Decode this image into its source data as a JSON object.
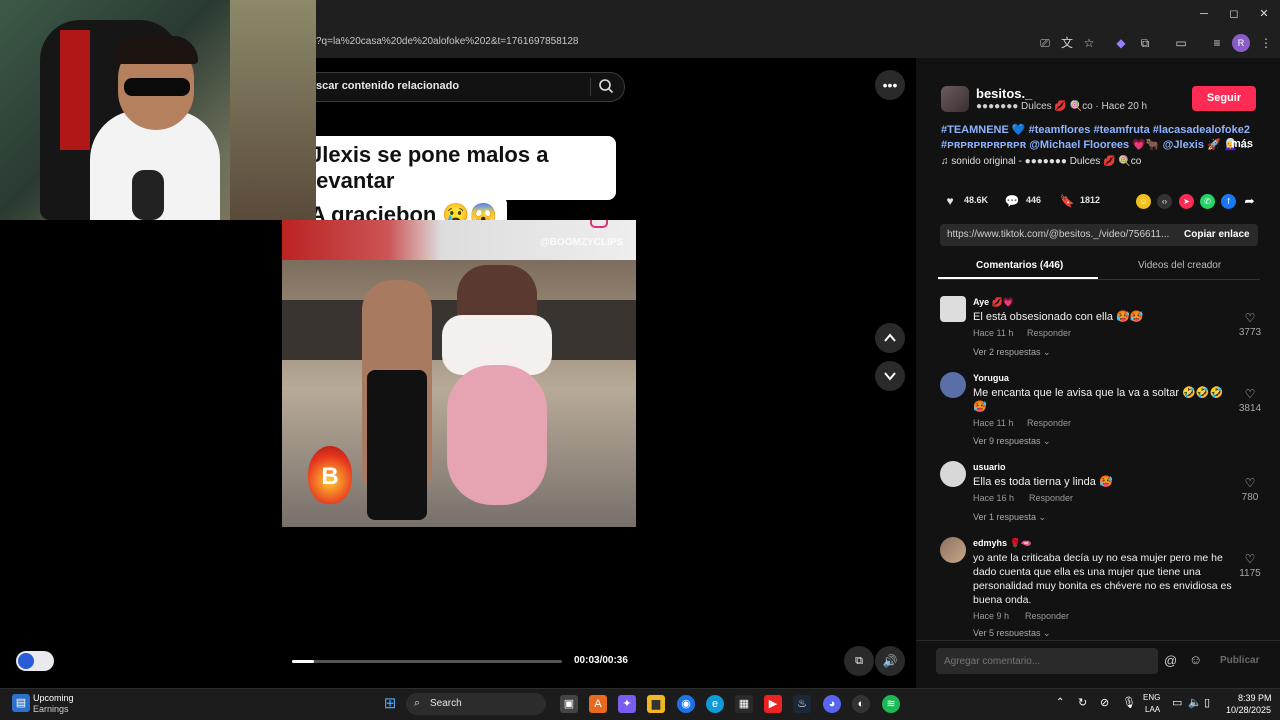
{
  "browser": {
    "url": "?q=la%20casa%20de%20alofoke%202&t=1761697858128",
    "window_controls": {
      "minimize": "─",
      "maximize": "◻",
      "close": "✕"
    },
    "profile_initial": "R"
  },
  "search": {
    "placeholder_text": "scar contenido relacionado"
  },
  "video": {
    "caption_line1": "Jlexis se pone malos a levantar",
    "caption_line2": "A graciebon 😢😱",
    "watermark": "@BOOMZYCLIPS",
    "badge_letter": "B",
    "time": "00:03/00:36",
    "progress": 0.083
  },
  "post": {
    "username": "besitos._",
    "subline": "●●●●●●● Dulces 💋 🍭co · Hace 20 h",
    "follow_label": "Seguir",
    "hashtags": "#TEAMNENE 💙 #teamflores #teamfruta #lacasadealofoke2 #ᴘʀᴘʀᴘʀᴘʀᴘʀᴘʀ @Michael Floorees 💗🐂 @Jlexis 🚀 👩‍🦳 ...",
    "more_label": "más",
    "sound": "♫  sonido original - ●●●●●●● Dulces 💋 🍭co",
    "likes": "48.6K",
    "comments": "446",
    "saves": "1812",
    "link": "https://www.tiktok.com/@besitos._/video/756611...",
    "copy_label": "Copiar enlace"
  },
  "tabs": {
    "comments": "Comentarios (446)",
    "videos": "Videos del creador"
  },
  "comments": [
    {
      "user": "Aye 💋💗",
      "text": "El está obsesionado con ella 🥵🥵",
      "time": "Hace 11 h",
      "reply": "Responder",
      "more": "Ver 2 respuestas ⌄",
      "likes": "3773"
    },
    {
      "user": "Yorugua",
      "text": "Me encanta que le avisa que la va a soltar 🤣🤣🤣",
      "text2": "🥵",
      "time": "Hace 11 h",
      "reply": "Responder",
      "more": "Ver 9 respuestas ⌄",
      "likes": "3814"
    },
    {
      "user": "usuario",
      "text": "Ella es toda tierna y linda 🥵",
      "time": "Hace 16 h",
      "reply": "Responder",
      "more": "Ver 1 respuesta ⌄",
      "likes": "780"
    },
    {
      "user": "edmyhs 🌹🫦",
      "text": "yo ante la criticaba decía uy no esa mujer pero me he dado cuenta que ella es una mujer que tiene una personalidad muy bonita es chévere no es envidiosa es buena onda.",
      "time": "Hace 9 h",
      "reply": "Responder",
      "more": "Ver 5 respuestas ⌄",
      "likes": "1175"
    }
  ],
  "comment_input": {
    "placeholder": "Agregar comentario..."
  },
  "publish_label": "Publicar",
  "taskbar": {
    "widget_title": "Upcoming",
    "widget_sub": "Earnings",
    "search_label": "Search",
    "lang1": "ENG",
    "lang2": "LAA",
    "time": "8:39 PM",
    "date": "10/28/2025"
  },
  "colors": {
    "follow": "#fe2c55",
    "hashtag": "#8fb4ff",
    "panel_bg": "#121212"
  }
}
